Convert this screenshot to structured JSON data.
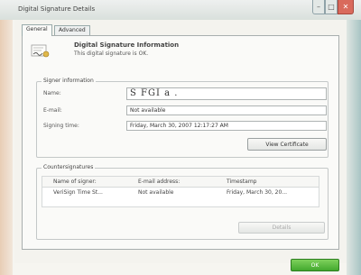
{
  "window": {
    "title": "Digital Signature Details"
  },
  "tabs": [
    {
      "label": "General",
      "active": true
    },
    {
      "label": "Advanced",
      "active": false
    }
  ],
  "info": {
    "icon": "signature-certificate-icon",
    "heading": "Digital Signature Information",
    "subtext": "This digital signature is OK."
  },
  "signer": {
    "group_label": "Signer information",
    "name_label": "Name:",
    "name_value": "S FGI a .",
    "email_label": "E-mail:",
    "email_value": "Not available",
    "time_label": "Signing time:",
    "time_value": "Friday, March 30, 2007 12:17:27 AM",
    "view_cert_label": "View Certificate"
  },
  "countersignatures": {
    "group_label": "Countersignatures",
    "columns": [
      "Name of signer:",
      "E-mail address:",
      "Timestamp"
    ],
    "rows": [
      [
        "VeriSign Time St...",
        "Not available",
        "Friday, March 30, 20..."
      ]
    ],
    "details_label": "Details"
  },
  "footer": {
    "ok_label": "OK"
  },
  "colors": {
    "close_button": "#d96a5c",
    "ok_button": "#43a82e"
  }
}
